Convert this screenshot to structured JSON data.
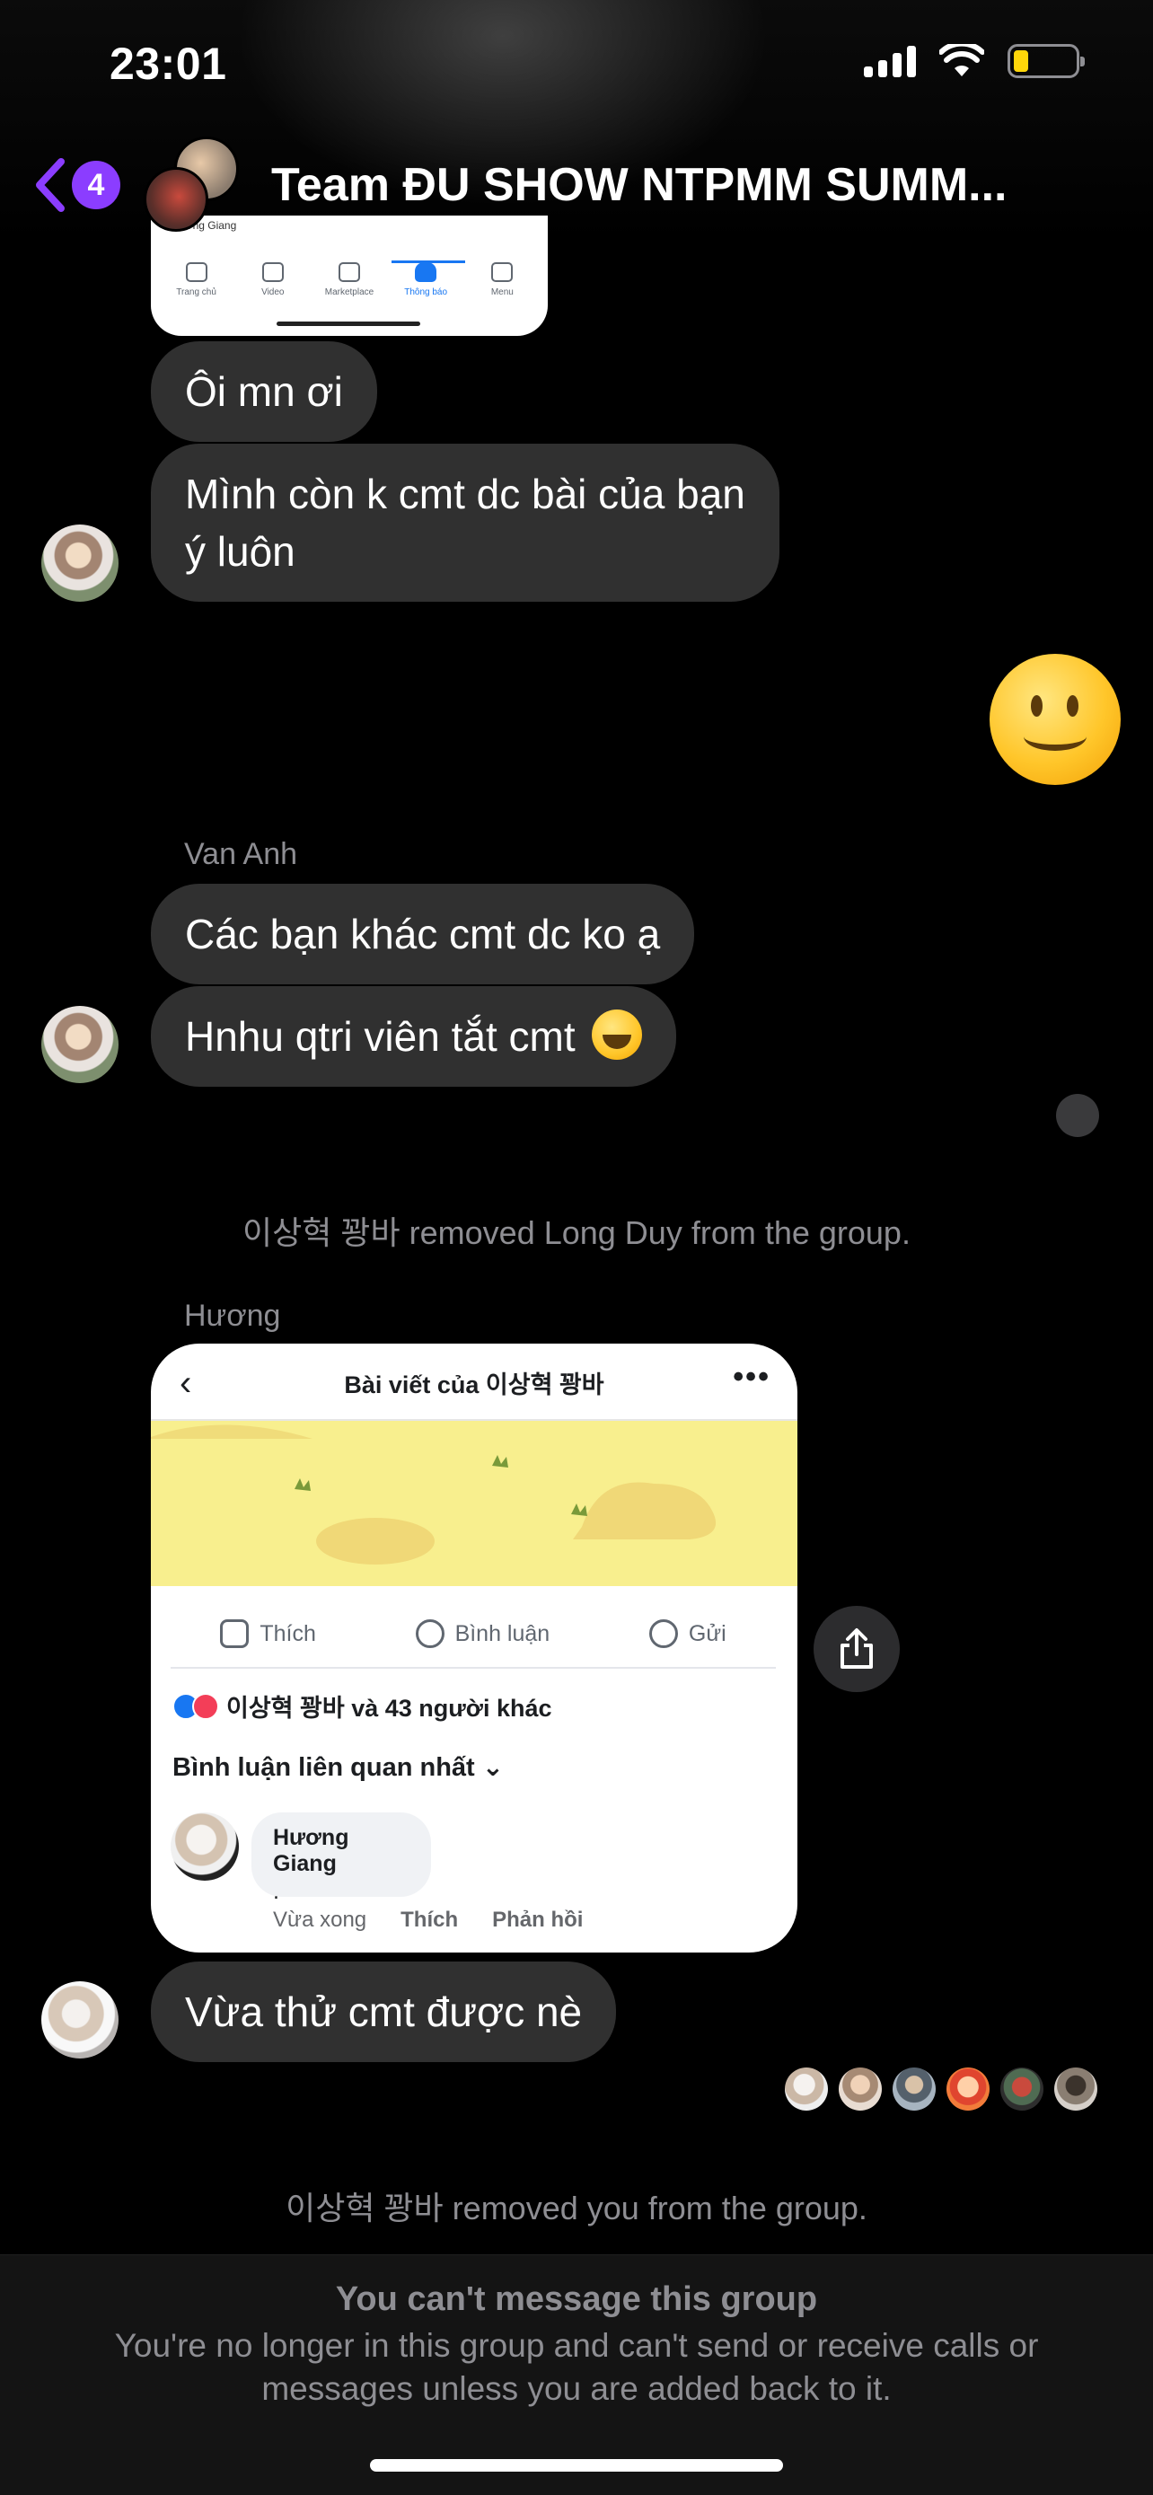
{
  "status_bar": {
    "time": "23:01",
    "battery_color": "#ffd60a"
  },
  "header": {
    "back_count": "4",
    "title": "Team ĐU SHOW NTPMM SUMM...",
    "accent_color": "#8b3dff"
  },
  "top_screenshot": {
    "peek_name": "Hương Giang",
    "nav": [
      "Trang chủ",
      "Video",
      "Marketplace",
      "Thông báo",
      "Menu"
    ]
  },
  "messages": {
    "m1": "Ôi mn ơi",
    "m2_line1": "Mình còn k cmt dc bài của bạn",
    "m2_line2": "ý luôn",
    "van_anh": "Van Anh",
    "m3": "Các bạn khác cmt dc ko ạ",
    "m4": "Hnhu qtri viên tắt cmt",
    "system1": "이상혁 꽝바 removed Long Duy from the group.",
    "huong": "Hương",
    "m5": "Vừa thử cmt được nè",
    "system2": "이상혁 꽝바 removed you from the group."
  },
  "post": {
    "title": "Bài viết của 이상혁 꽝바",
    "more": "•••",
    "like": "Thích",
    "comment": "Bình luận",
    "send": "Gửi",
    "reactions": "이상혁 꽝바 và 43 người khác",
    "related": "Bình luận liên quan nhất",
    "commenter": "Hương Giang",
    "comment_text": ".",
    "time": "Vừa xong",
    "reply_like": "Thích",
    "reply": "Phản hồi"
  },
  "footer": {
    "title": "You can't message this group",
    "body": "You're no longer in this group and can't send or receive calls or messages unless you are added back to it."
  }
}
